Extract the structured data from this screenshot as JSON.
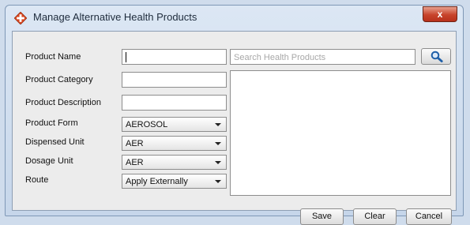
{
  "window": {
    "title": "Manage Alternative Health Products",
    "close_label": "x",
    "app_icon": "diamond-cross-icon"
  },
  "form": {
    "product_name": {
      "label": "Product Name",
      "value": ""
    },
    "product_category": {
      "label": "Product Category",
      "value": ""
    },
    "product_description": {
      "label": "Product Description",
      "value": ""
    },
    "product_form": {
      "label": "Product Form",
      "value": "AEROSOL"
    },
    "dispensed_unit": {
      "label": "Dispensed Unit",
      "value": "AER"
    },
    "dosage_unit": {
      "label": "Dosage Unit",
      "value": "AER"
    },
    "route": {
      "label": "Route",
      "value": "Apply Externally"
    }
  },
  "search": {
    "placeholder": "Search Health Products",
    "value": "",
    "button_icon": "magnifier-icon"
  },
  "buttons": {
    "save": "Save",
    "clear": "Clear",
    "cancel": "Cancel"
  },
  "colors": {
    "accent_red": "#d8461f",
    "close_button": "#c7432b",
    "search_icon": "#1f5fa8"
  }
}
